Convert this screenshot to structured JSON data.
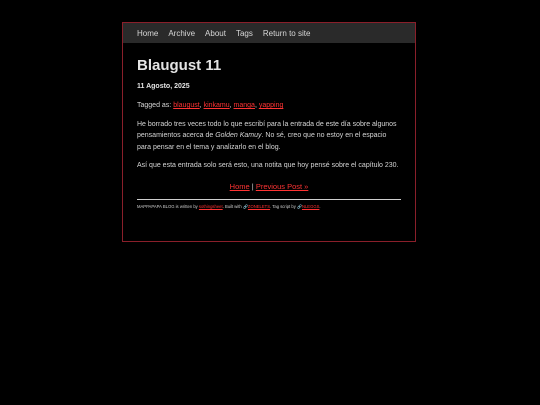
{
  "nav": {
    "items": [
      {
        "label": "Home"
      },
      {
        "label": "Archive"
      },
      {
        "label": "About"
      },
      {
        "label": "Tags"
      },
      {
        "label": "Return to site"
      }
    ]
  },
  "post": {
    "title": "Blaugust 11",
    "date": "11 Agosto, 2025",
    "tagged_prefix": "Tagged as:",
    "tags": [
      "blaugust",
      "kinkamu",
      "manga",
      "yapping"
    ],
    "paragraph1_a": "He borrado tres veces todo lo que escribí para la entrada de este día sobre algunos pensamientos acerca de ",
    "paragraph1_em": "Golden Kamuy",
    "paragraph1_b": ". No sé, creo que no estoy en el espacio para pensar en el tema y analizarlo en el blog.",
    "paragraph2": "Así que esta entrada solo será esto, una notita que hoy pensé sobre el capítulo 230."
  },
  "pager": {
    "home_label": "Home",
    "separator": "|",
    "prev_label": "Previous Post »"
  },
  "footer": {
    "prefix": "MAPPAPAPA BLOG is written by",
    "author": "sothingsheet",
    "built_with": ". Built with",
    "built_link": "ZONELETS",
    "tag_script": ". Tag script by",
    "tag_link": "NLEGGS",
    "suffix": "."
  },
  "colors": {
    "accent": "#ff3333",
    "border": "#8a1f2a",
    "nav_bg": "#2a2a2a",
    "background": "#000000"
  }
}
